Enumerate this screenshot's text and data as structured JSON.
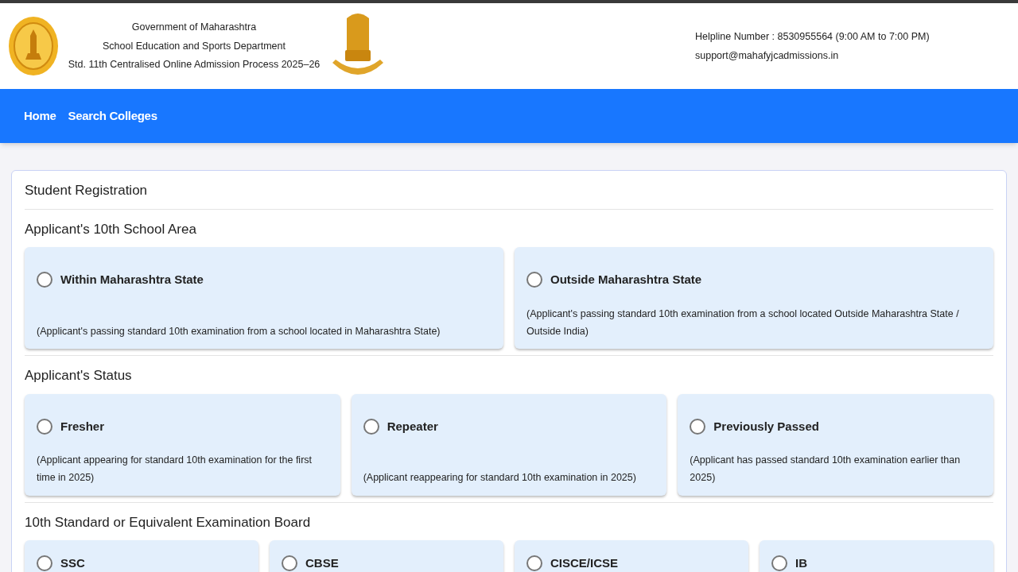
{
  "header": {
    "lines": [
      "Government of Maharashtra",
      "School Education and Sports Department",
      "Std. 11th Centralised Online Admission Process 2025–26"
    ],
    "helpline": "Helpline Number : 8530955564 (9:00 AM to 7:00 PM)",
    "email": "support@mahafyjcadmissions.in"
  },
  "nav": [
    "Home",
    "Search Colleges"
  ],
  "form": {
    "title": "Student Registration",
    "sections": [
      {
        "title": "Applicant's 10th School Area",
        "options": [
          {
            "label": "Within Maharashtra State",
            "description": "(Applicant's passing standard 10th examination from a school located in Maharashtra State)",
            "selected": false
          },
          {
            "label": "Outside Maharashtra State",
            "description": "(Applicant's passing standard 10th examination from a school located Outside Maharashtra State / Outside India)",
            "selected": false
          }
        ]
      },
      {
        "title": "Applicant's Status",
        "options": [
          {
            "label": "Fresher",
            "description": "(Applicant appearing for standard 10th examination for the first time in 2025)",
            "selected": false
          },
          {
            "label": "Repeater",
            "description": "(Applicant reappearing for standard 10th examination in 2025)",
            "selected": false
          },
          {
            "label": "Previously Passed",
            "description": "(Applicant has passed standard 10th examination earlier than 2025)",
            "selected": false
          }
        ]
      },
      {
        "title": "10th Standard or Equivalent Examination Board",
        "options": [
          {
            "label": "SSC",
            "selected": false
          },
          {
            "label": "CBSE",
            "selected": false
          },
          {
            "label": "CISCE/ICSE",
            "selected": false
          },
          {
            "label": "IB",
            "selected": false
          }
        ]
      }
    ]
  }
}
